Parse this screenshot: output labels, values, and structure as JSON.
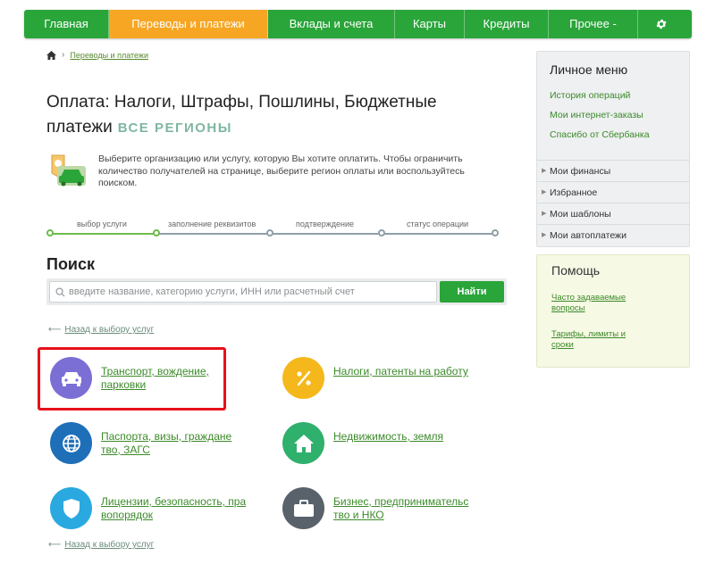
{
  "nav": {
    "items": [
      "Главная",
      "Переводы и платежи",
      "Вклады и счета",
      "Карты",
      "Кредиты",
      "Прочее -"
    ],
    "active_index": 1
  },
  "breadcrumb": {
    "link": "Переводы и платежи"
  },
  "title": {
    "text": "Оплата: Налоги, Штрафы, Пошлины, Бюджетные платежи",
    "regions": "ВСЕ РЕГИОНЫ"
  },
  "intro": "Выберите организацию или услугу, которую Вы хотите оплатить. Чтобы ограничить количество получателей на странице, выберите регион оплаты или воспользуйтесь поиском.",
  "steps": [
    "выбор услуги",
    "заполнение реквизитов",
    "подтверждение",
    "статус операции"
  ],
  "search": {
    "heading": "Поиск",
    "placeholder": "введите название, категорию услуги, ИНН или расчетный счет",
    "button": "Найти"
  },
  "back_link": "Назад к выбору услуг",
  "categories": [
    {
      "label": "Транспорт, вождение, парковки",
      "icon": "car-icon",
      "color": "#7b6fd6"
    },
    {
      "label": "Налоги, патенты на работу",
      "icon": "percent-icon",
      "color": "#f5b81c"
    },
    {
      "label": "Паспорта, визы, граждане тво, ЗАГС",
      "icon": "globe-icon",
      "color": "#1e6fb8"
    },
    {
      "label": "Недвижимость, земля",
      "icon": "house-icon",
      "color": "#2fb06c"
    },
    {
      "label": "Лицензии, безопасность, пра вопорядок",
      "icon": "shield-icon",
      "color": "#2aa9e0"
    },
    {
      "label": "Бизнес, предпринимательс тво и НКО",
      "icon": "briefcase-icon",
      "color": "#59626b"
    }
  ],
  "personal_menu": {
    "heading": "Личное меню",
    "links": [
      "История операций",
      "Мои интернет-заказы",
      "Спасибо от Сбербанка"
    ],
    "rows": [
      "Мои финансы",
      "Избранное",
      "Мои шаблоны",
      "Мои автоплатежи"
    ]
  },
  "help": {
    "heading": "Помощь",
    "links": [
      "Часто задаваемые вопросы",
      "Тарифы, лимиты и сроки"
    ]
  },
  "colors": {
    "brand_green": "#2aa53a",
    "active_orange": "#f6a623",
    "highlight_red": "#e8101b"
  }
}
